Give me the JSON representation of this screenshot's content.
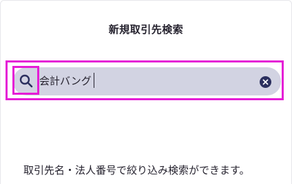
{
  "dialog": {
    "title": "新規取引先検索"
  },
  "search": {
    "value": "会計バング",
    "placeholder": ""
  },
  "icons": {
    "search": "search-icon",
    "clear": "close-circle-icon"
  },
  "help": {
    "text": "取引先名・法人番号で絞り込み検索ができます。"
  },
  "colors": {
    "highlight": "#e51dd6",
    "search_background": "#d2d3e2",
    "icon": "#2b2f5e",
    "text": "#26232f"
  }
}
